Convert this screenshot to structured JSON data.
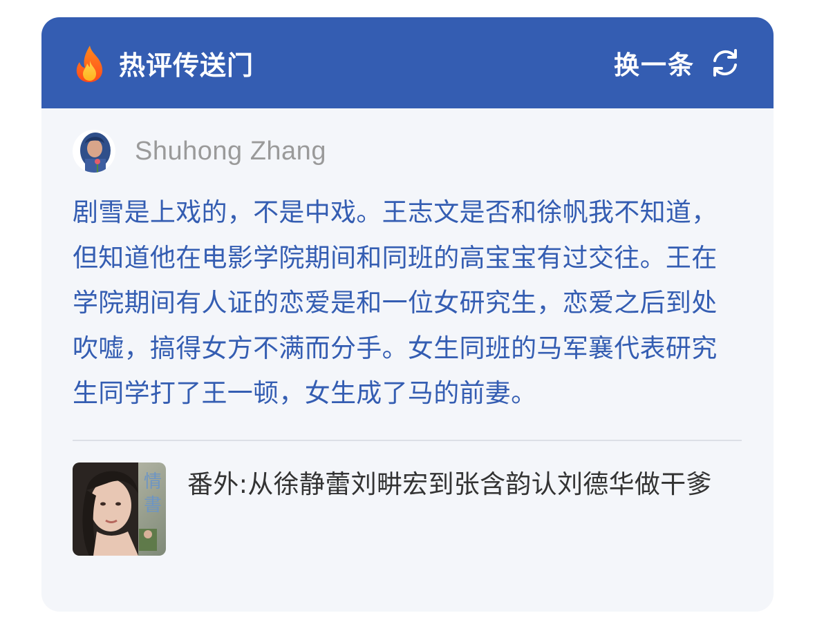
{
  "header": {
    "title": "热评传送门",
    "refresh_label": "换一条",
    "icons": {
      "left": "fire-icon",
      "right": "refresh-icon"
    },
    "background_color": "#345db2"
  },
  "comment": {
    "author": "Shuhong Zhang",
    "avatar": "user-avatar",
    "text": "剧雪是上戏的，不是中戏。王志文是否和徐帆我不知道，但知道他在电影学院期间和同班的高宝宝有过交往。王在学院期间有人证的恋爱是和一位女研究生，恋爱之后到处吹嘘，搞得女方不满而分手。女生同班的马军襄代表研究生同学打了王一顿，女生成了马的前妻。",
    "text_color": "#345db2"
  },
  "related_article": {
    "thumbnail": "article-thumbnail",
    "thumbnail_text": "情書",
    "title": "番外:从徐静蕾刘畊宏到张含韵认刘德华做干爹"
  }
}
